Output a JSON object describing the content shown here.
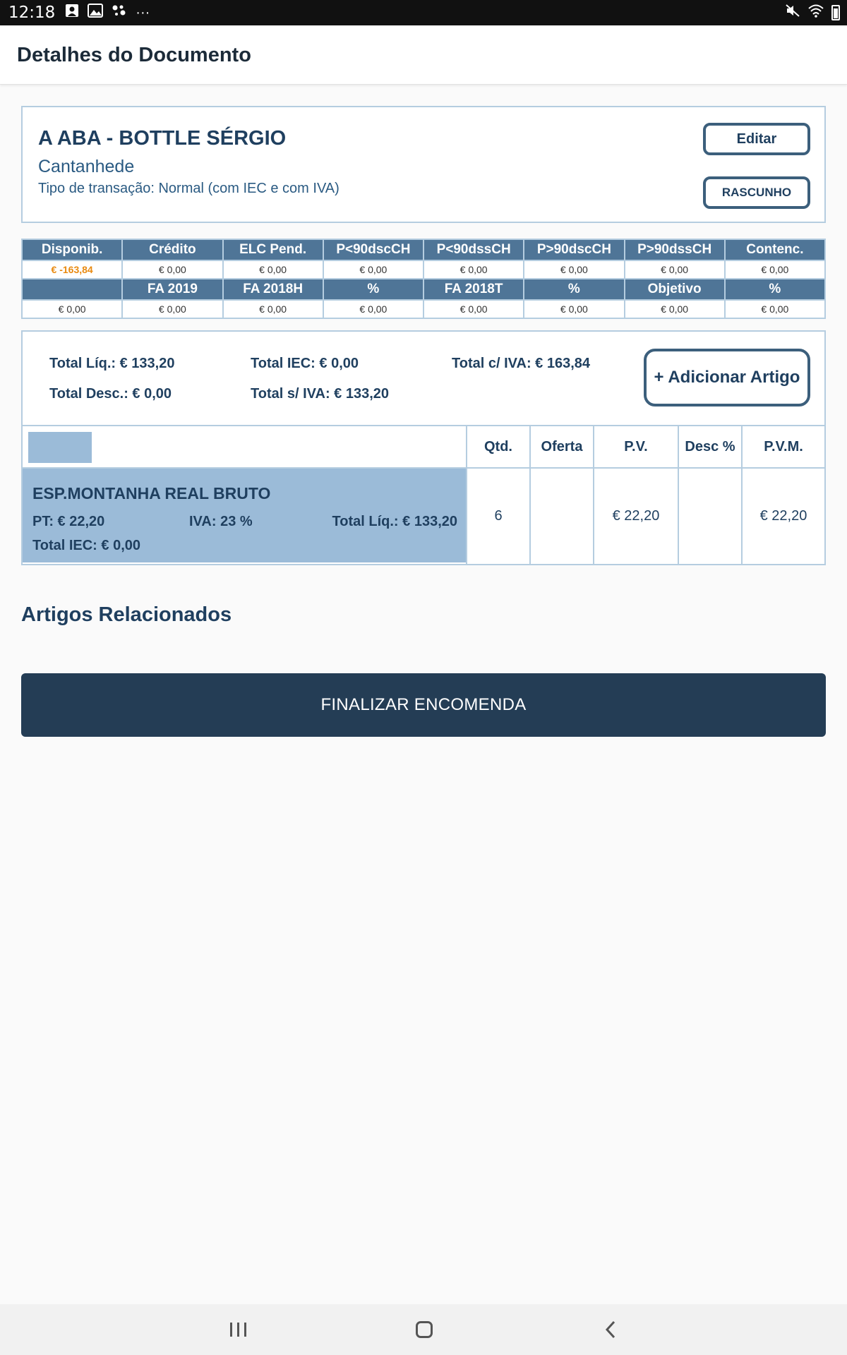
{
  "status_bar": {
    "time": "12:18",
    "left_icons": [
      "contact-notification-icon",
      "image-notification-icon",
      "assistant-icon",
      "more-icon"
    ],
    "more_glyph": "···",
    "right_icons": [
      "mute-icon",
      "wifi-icon",
      "battery-icon"
    ]
  },
  "app_bar": {
    "title": "Detalhes do Documento"
  },
  "customer": {
    "name": "A ABA - BOTTLE SÉRGIO",
    "city": "Cantanhede",
    "transaction_type": "Tipo de transação: Normal (com IEC e com IVA)",
    "edit_label": "Editar",
    "draft_label": "RASCUNHO"
  },
  "stats": {
    "header1": [
      "Disponib.",
      "Crédito",
      "ELC Pend.",
      "P<90dscCH",
      "P<90dssCH",
      "P>90dscCH",
      "P>90dssCH",
      "Contenc."
    ],
    "values1": [
      "€ -163,84",
      "€ 0,00",
      "€ 0,00",
      "€ 0,00",
      "€ 0,00",
      "€ 0,00",
      "€ 0,00",
      "€ 0,00"
    ],
    "header2": [
      "",
      "FA 2019",
      "FA 2018H",
      "%",
      "FA 2018T",
      "%",
      "Objetivo",
      "%"
    ],
    "values2": [
      "€ 0,00",
      "€ 0,00",
      "€ 0,00",
      "€ 0,00",
      "€ 0,00",
      "€ 0,00",
      "€ 0,00",
      "€ 0,00"
    ],
    "negative_color": "#e98a10"
  },
  "totals": {
    "total_liq": "Total Líq.: € 133,20",
    "total_iec": "Total IEC: € 0,00",
    "total_com_iva": "Total c/ IVA: € 163,84",
    "total_desc": "Total Desc.: € 0,00",
    "total_sem_iva": "Total s/ IVA: € 133,20",
    "add_item_label": "+ Adicionar Artigo"
  },
  "items_table": {
    "columns": [
      "Qtd.",
      "Oferta",
      "P.V.",
      "Desc %",
      "P.V.M."
    ],
    "rows": [
      {
        "name": "ESP.MONTANHA REAL BRUTO",
        "pt": "PT: € 22,20",
        "iva": "IVA: 23  %",
        "total_liq": "Total Líq.: € 133,20",
        "total_iec": "Total IEC: € 0,00",
        "qtd": "6",
        "oferta": "",
        "pv": "€ 22,20",
        "desc": "",
        "pvm": "€ 22,20"
      }
    ]
  },
  "related_title": "Artigos Relacionados",
  "finish_label": "FINALIZAR ENCOMENDA",
  "colors": {
    "primary_dark": "#243d55",
    "table_header": "#4f7597",
    "highlight": "#9bbbd8",
    "border": "#b5cde0"
  },
  "nav_bar": [
    "recents-icon",
    "home-icon",
    "back-icon"
  ]
}
